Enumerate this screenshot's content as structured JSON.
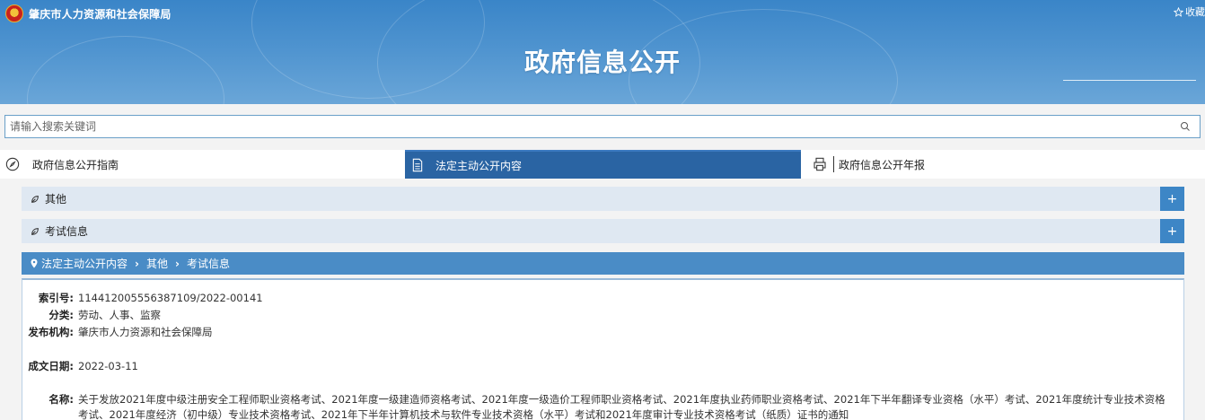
{
  "header": {
    "org_name": "肇庆市人力资源和社会保障局",
    "favorite_label": "收藏",
    "page_title": "政府信息公开"
  },
  "search": {
    "placeholder": "请输入搜索关键词"
  },
  "nav": {
    "tabs": [
      {
        "label": "政府信息公开指南",
        "active": false
      },
      {
        "label": "法定主动公开内容",
        "active": true
      },
      {
        "label": "政府信息公开年报",
        "active": false
      }
    ]
  },
  "accordion": [
    {
      "label": "其他",
      "toggle": "+"
    },
    {
      "label": "考试信息",
      "toggle": "+"
    }
  ],
  "breadcrumb": [
    "法定主动公开内容",
    "其他",
    "考试信息"
  ],
  "detail": {
    "index_label": "索引号:",
    "index_value": "114412005556387109/2022-00141",
    "category_label": "分类:",
    "category_value": "劳动、人事、监察",
    "publisher_label": "发布机构:",
    "publisher_value": "肇庆市人力资源和社会保障局",
    "date_label": "成文日期:",
    "date_value": "2022-03-11",
    "name_label": "名称:",
    "name_value": "关于发放2021年度中级注册安全工程师职业资格考试、2021年度一级建造师资格考试、2021年度一级造价工程师职业资格考试、2021年度执业药师职业资格考试、2021年下半年翻译专业资格（水平）考试、2021年度统计专业技术资格考试、2021年度经济（初中级）专业技术资格考试、2021年下半年计算机技术与软件专业技术资格（水平）考试和2021年度审计专业技术资格考试（纸质）证书的通知"
  },
  "colors": {
    "header_blue": "#3a85c8",
    "active_tab": "#2a64a3",
    "breadcrumb_bar": "#4a8cc6",
    "accordion_bg": "#dfe8f2",
    "plus_button": "#3d86c6"
  }
}
